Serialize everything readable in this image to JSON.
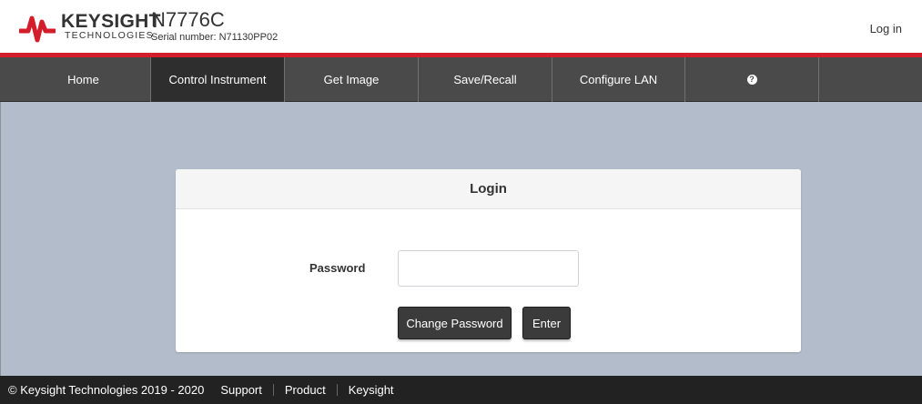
{
  "header": {
    "brand_name": "KEYSIGHT",
    "brand_sub": "TECHNOLOGIES",
    "model": "N7776C",
    "serial": "Serial number: N71130PP02",
    "login_link": "Log in"
  },
  "nav": {
    "items": [
      {
        "label": "Home"
      },
      {
        "label": "Control Instrument"
      },
      {
        "label": "Get Image"
      },
      {
        "label": "Save/Recall"
      },
      {
        "label": "Configure LAN"
      }
    ],
    "help_glyph": "?",
    "active": "Control Instrument"
  },
  "login": {
    "title": "Login",
    "password_label": "Password",
    "password_value": "",
    "change_password_label": "Change Password",
    "enter_label": "Enter"
  },
  "footer": {
    "copyright": "© Keysight Technologies 2019 - 2020",
    "links": [
      "Support",
      "Product",
      "Keysight"
    ]
  },
  "colors": {
    "accent_red": "#d41d2a",
    "nav_bg": "#4a4a4a",
    "nav_active_bg": "#2e2e2e",
    "page_bg": "#b3bccb",
    "footer_bg": "#222222"
  }
}
